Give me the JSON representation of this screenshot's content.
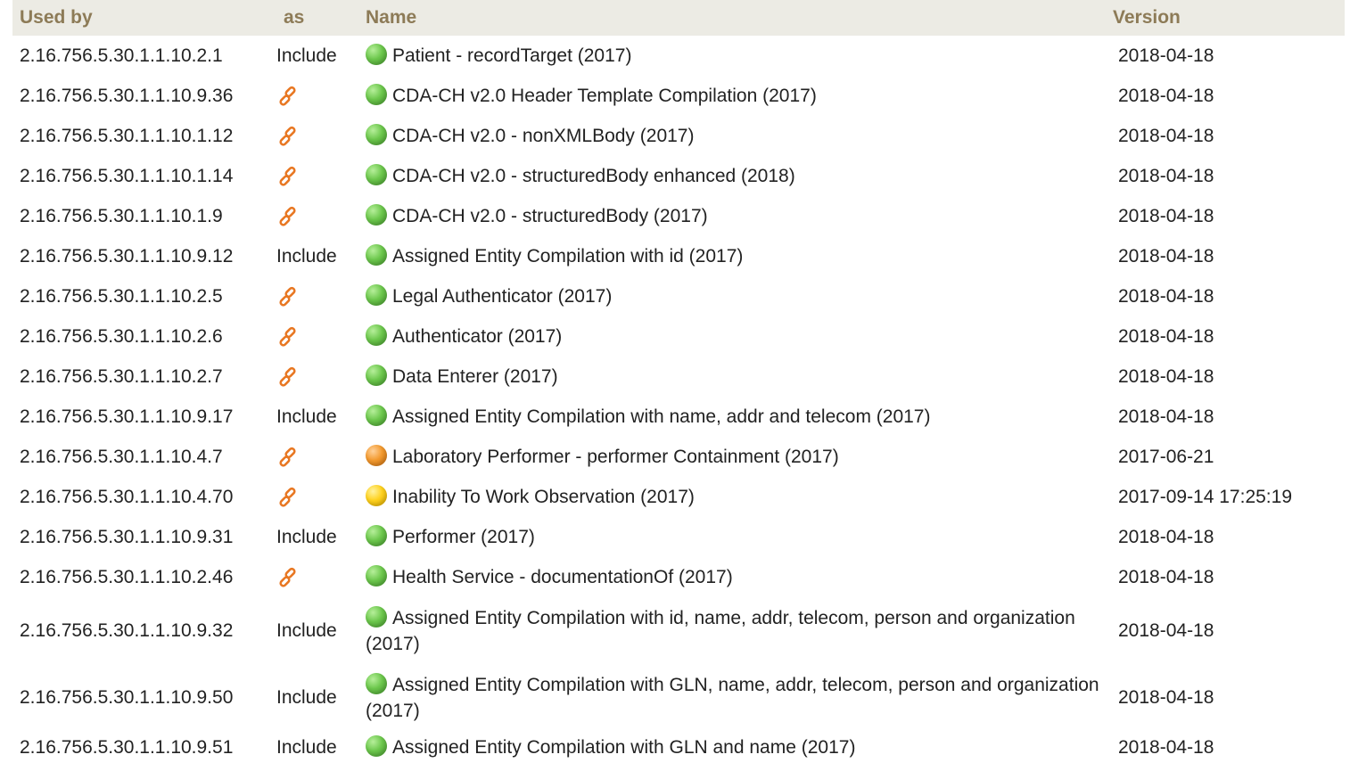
{
  "table": {
    "headers": {
      "used_by": "Used by",
      "as": "as",
      "name": "Name",
      "version": "Version"
    },
    "rows": [
      {
        "used_by": "2.16.756.5.30.1.1.10.2.1",
        "as": "Include",
        "status": "green",
        "name": "Patient - recordTarget (2017)",
        "version": "2018-04-18"
      },
      {
        "used_by": "2.16.756.5.30.1.1.10.9.36",
        "as": "",
        "status": "green",
        "name": "CDA-CH v2.0 Header Template Compilation (2017)",
        "version": "2018-04-18"
      },
      {
        "used_by": "2.16.756.5.30.1.1.10.1.12",
        "as": "",
        "status": "green",
        "name": "CDA-CH v2.0 - nonXMLBody (2017)",
        "version": "2018-04-18"
      },
      {
        "used_by": "2.16.756.5.30.1.1.10.1.14",
        "as": "",
        "status": "green",
        "name": "CDA-CH v2.0 - structuredBody enhanced (2018)",
        "version": "2018-04-18"
      },
      {
        "used_by": "2.16.756.5.30.1.1.10.1.9",
        "as": "",
        "status": "green",
        "name": "CDA-CH v2.0 - structuredBody (2017)",
        "version": "2018-04-18"
      },
      {
        "used_by": "2.16.756.5.30.1.1.10.9.12",
        "as": "Include",
        "status": "green",
        "name": "Assigned Entity Compilation with id (2017)",
        "version": "2018-04-18"
      },
      {
        "used_by": "2.16.756.5.30.1.1.10.2.5",
        "as": "",
        "status": "green",
        "name": "Legal Authenticator (2017)",
        "version": "2018-04-18"
      },
      {
        "used_by": "2.16.756.5.30.1.1.10.2.6",
        "as": "",
        "status": "green",
        "name": "Authenticator (2017)",
        "version": "2018-04-18"
      },
      {
        "used_by": "2.16.756.5.30.1.1.10.2.7",
        "as": "",
        "status": "green",
        "name": "Data Enterer (2017)",
        "version": "2018-04-18"
      },
      {
        "used_by": "2.16.756.5.30.1.1.10.9.17",
        "as": "Include",
        "status": "green",
        "name": "Assigned Entity Compilation with name, addr and telecom (2017)",
        "version": "2018-04-18"
      },
      {
        "used_by": "2.16.756.5.30.1.1.10.4.7",
        "as": "",
        "status": "orange",
        "name": "Laboratory Performer - performer Containment (2017)",
        "version": "2017-06-21"
      },
      {
        "used_by": "2.16.756.5.30.1.1.10.4.70",
        "as": "",
        "status": "yellow",
        "name": "Inability To Work Observation (2017)",
        "version": "2017-09-14 17:25:19"
      },
      {
        "used_by": "2.16.756.5.30.1.1.10.9.31",
        "as": "Include",
        "status": "green",
        "name": "Performer (2017)",
        "version": "2018-04-18"
      },
      {
        "used_by": "2.16.756.5.30.1.1.10.2.46",
        "as": "",
        "status": "green",
        "name": "Health Service - documentationOf (2017)",
        "version": "2018-04-18"
      },
      {
        "used_by": "2.16.756.5.30.1.1.10.9.32",
        "as": "Include",
        "status": "green",
        "name": "Assigned Entity Compilation with id, name, addr, telecom, person and or­ganization (2017)",
        "version": "2018-04-18"
      },
      {
        "used_by": "2.16.756.5.30.1.1.10.9.50",
        "as": "Include",
        "status": "green",
        "name": "Assigned Entity Compilation with GLN, name, addr, telecom, person and organization (2017)",
        "version": "2018-04-18"
      },
      {
        "used_by": "2.16.756.5.30.1.1.10.9.51",
        "as": "Include",
        "status": "green",
        "name": "Assigned Entity Compilation with GLN and name (2017)",
        "version": "2018-04-18"
      }
    ]
  },
  "icons": {
    "contains": "link-icon"
  },
  "colors": {
    "header_bg": "#ecebe4",
    "header_text": "#8d7b57",
    "link_icon": "#e87722",
    "status_green": "#5cb83e",
    "status_orange": "#f08c1e",
    "status_yellow": "#ffd21e"
  }
}
